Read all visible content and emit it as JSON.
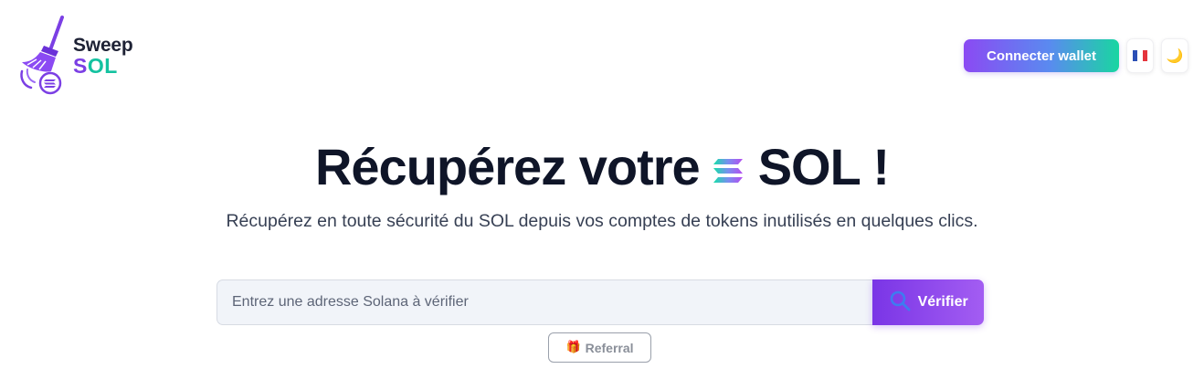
{
  "header": {
    "logo": {
      "line1": "Sweep",
      "line2_part1": "S",
      "line2_part2": "OL"
    },
    "connect_wallet_label": "Connecter wallet",
    "language": {
      "flag": "fr-flag-icon"
    },
    "theme_toggle": {
      "icon": "moon-icon",
      "glyph": "🌙"
    }
  },
  "hero": {
    "title_before": "Récupérez votre",
    "title_after": "SOL !",
    "subtitle": "Récupérez en toute sécurité du SOL depuis vos comptes de tokens inutilisés en quelques clics."
  },
  "search": {
    "placeholder": "Entrez une adresse Solana à vérifier",
    "value": "",
    "verify_label": "Vérifier"
  },
  "referral": {
    "icon": "🎁",
    "label": "Referral"
  },
  "colors": {
    "brand_purple": "#7b3fe4",
    "brand_teal": "#14c2a0",
    "title_dark": "#0f1528"
  }
}
